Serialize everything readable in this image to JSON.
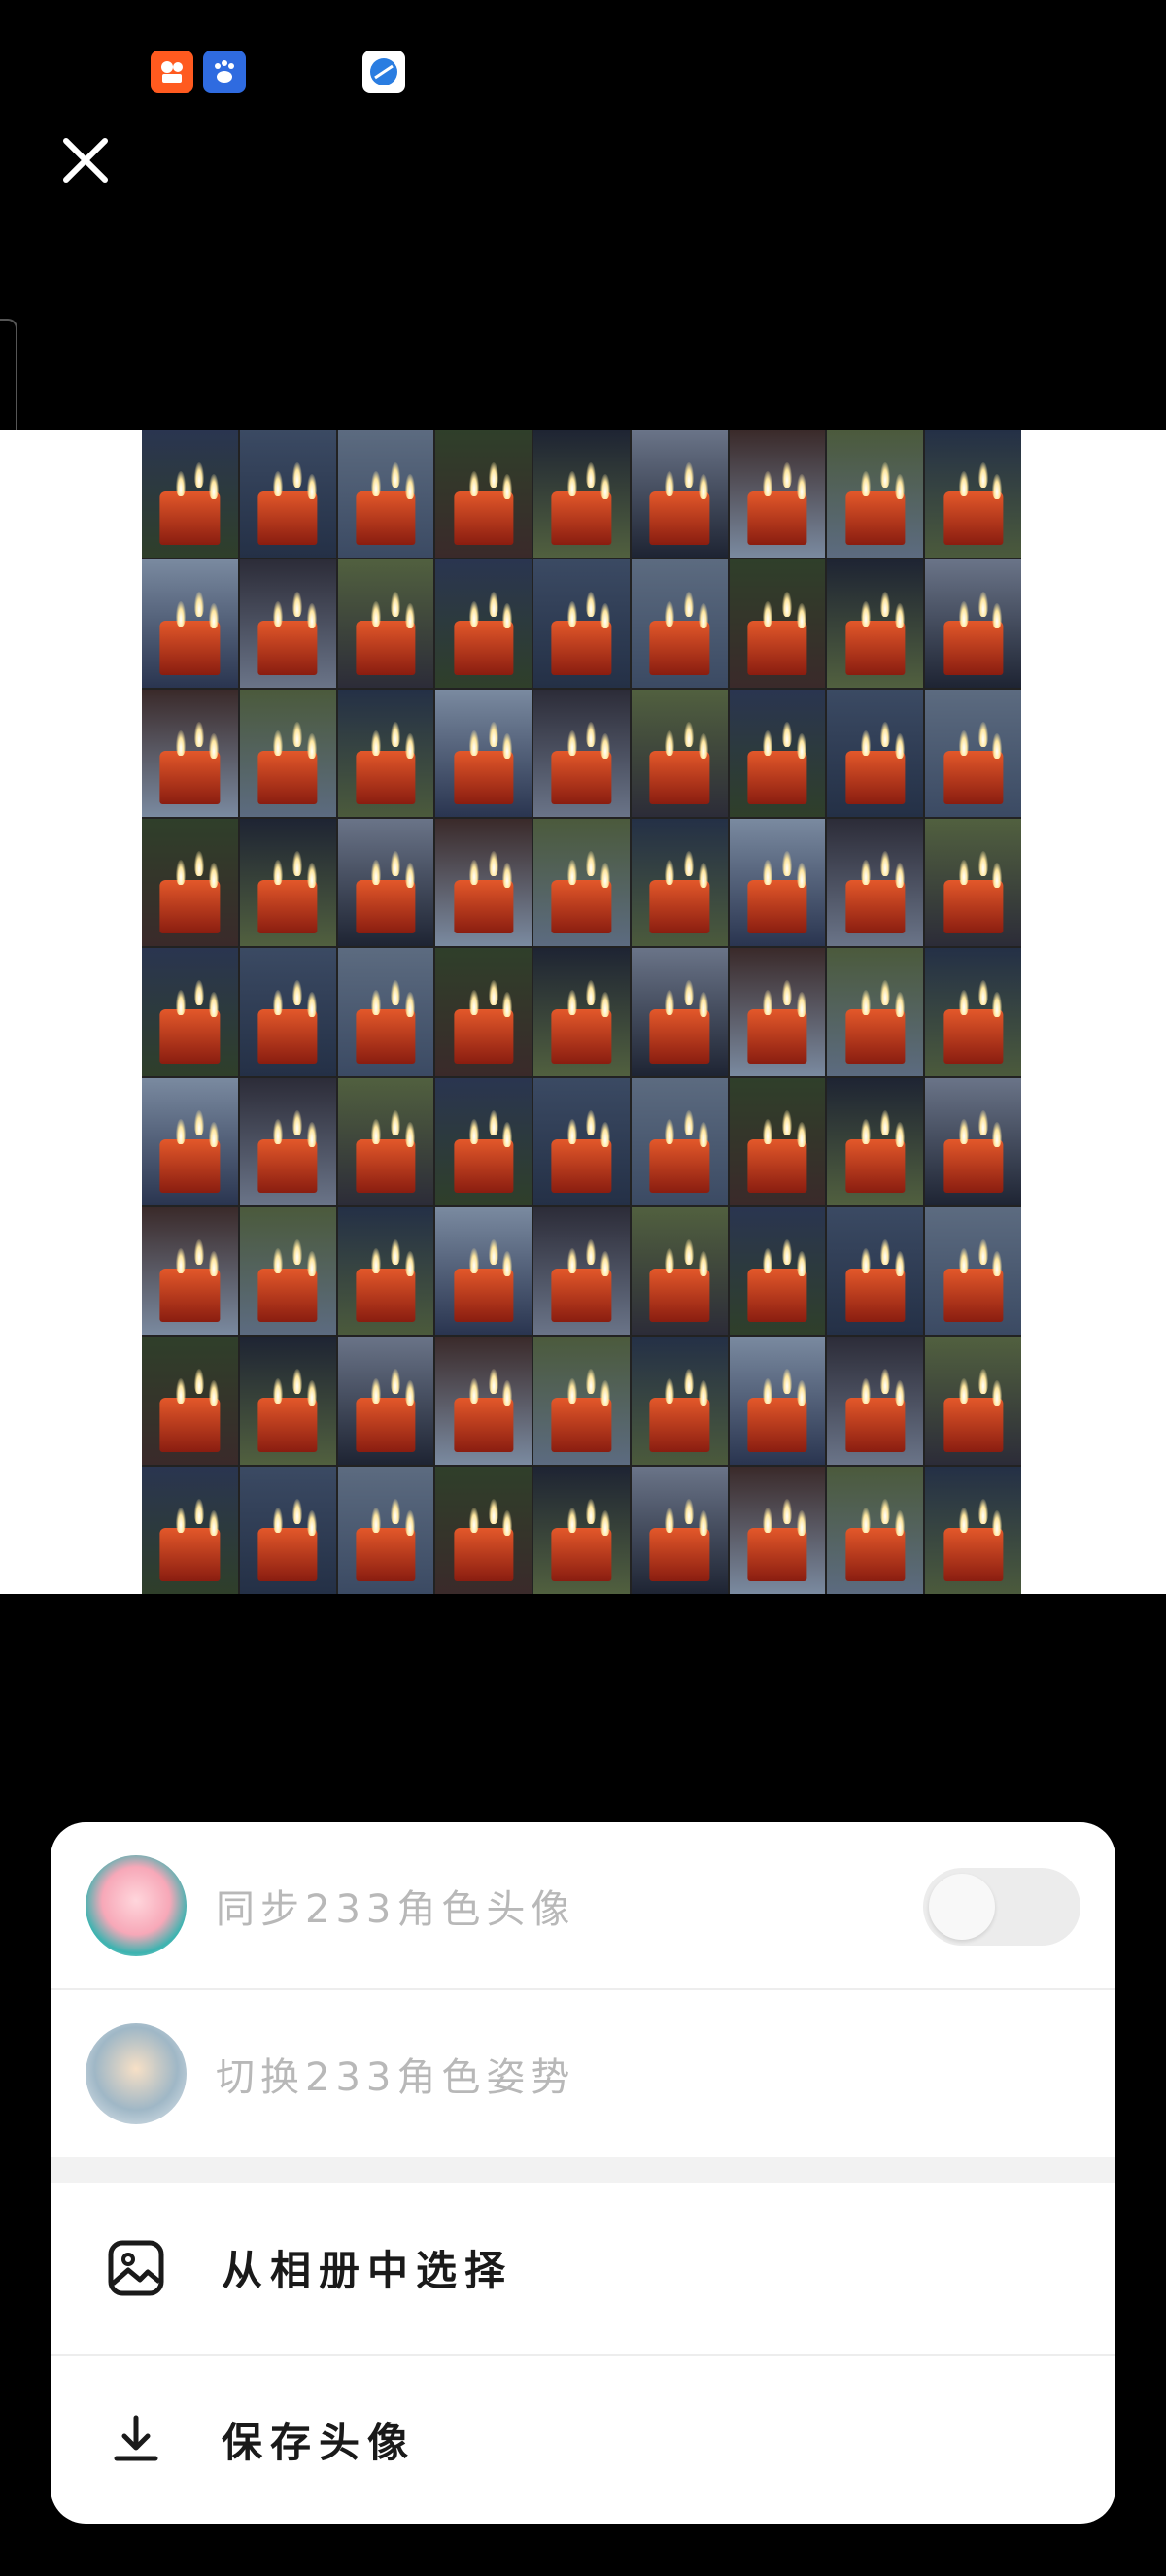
{
  "status_bar": {
    "icons": [
      "kuaishou-app-icon",
      "baidu-app-icon",
      "browser-app-icon"
    ]
  },
  "viewer": {
    "close_icon": "close-icon",
    "image_description_icon": "candle-grid-image",
    "grid": {
      "columns": 9,
      "rows": 9
    }
  },
  "sheet": {
    "sync_avatar": {
      "label": "同步233角色头像",
      "toggle_on": false
    },
    "switch_pose": {
      "label": "切换233角色姿势"
    },
    "choose_from_album": {
      "label": "从相册中选择",
      "icon": "gallery-icon"
    },
    "save_avatar": {
      "label": "保存头像",
      "icon": "download-icon"
    }
  },
  "colors": {
    "background": "#000000",
    "sheet_background": "#ffffff",
    "muted_text": "#b8b8b8",
    "primary_text": "#1a1a1a"
  }
}
